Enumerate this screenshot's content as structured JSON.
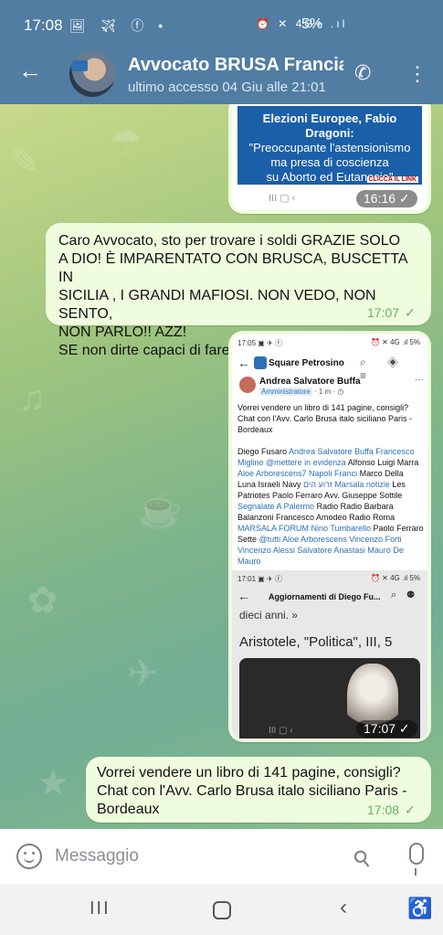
{
  "status_bar": {
    "time": "17:08",
    "left_icons": "🖼 ✈ ⓕ •",
    "right_icons": "⏰ ✕ 4G+ .ıl",
    "battery": "5%"
  },
  "header": {
    "contact_name": "Avvocato BRUSA Francia",
    "last_seen": "ultimo accesso 04 Giu alle 21:01",
    "back_icon": "arrow-left-icon",
    "call_icon": "phone-icon",
    "menu_icon": "more-vertical-icon"
  },
  "messages": {
    "image1": {
      "news_title": "Elezioni Europee, Fabio Dragoni:",
      "news_line1": "\"Preoccupante l'astensionismo",
      "news_line2": "ma presa di coscienza",
      "news_line3": "su Aborto ed Eutanasia\"",
      "news_link": "CLICCA IL LINK",
      "nav_glyphs": "III        ▢        ‹",
      "time": "16:16 ✓"
    },
    "text1": {
      "lines": [
        "Caro Avvocato, sto per trovare i soldi GRAZIE SOLO",
        "A DIO! È IMPARENTATO CON BRUSCA, BUSCETTA IN",
        "SICILIA , I GRANDI MAFIOSI. NON VEDO, NON SENTO,",
        "NON PARLO!! AZZ!",
        "SE non dirte capaci di fare il minimo. .."
      ],
      "time": "17:07",
      "tick": "✓"
    },
    "image2": {
      "status_time": "17:05 ▣ ✈ ⓕ",
      "status_right": "⏰ ✕ 4G .ıl 5%",
      "group_name": "Square Petrosino",
      "tools": "⌕ ◈ ≡",
      "author": "Andrea Salvatore Buffa",
      "role": "Amministratore",
      "age": "· 1 m · ◷",
      "more": "···",
      "post_text": "Vorrei vendere un libro di 141 pagine, consigli? Chat con l'Avv. Carlo Brusa italo siciliano Paris - Bordeaux",
      "tags_plain_1": "Diego Fusaro ",
      "tags_link_1": "Andrea Salvatore Buffa  Francesco Miglino  @mettere in evidenza",
      "tags_plain_2": "  Alfonso Luigi Marra  ",
      "tags_link_2": "Aloe Arborescens7  Napoli Franci",
      "tags_plain_3": "  Marco Della Luna  Israeli Navy ",
      "tags_link_3": "זרוע הים  Marsala notizie",
      "tags_plain_4": "  Les Patriotes  Paolo Ferraro  Avv. Giuseppe Sottile  ",
      "tags_link_4": "Segnalate A Palermo",
      "tags_plain_5": "  Radio Radio  Barbara Balanzoni  Francesco Amodeo  Radio Roma  ",
      "tags_link_5": "MARSALA FORUM  Nino Tumbarello",
      "tags_plain_6": "  Paolo Ferraro Sette  ",
      "tags_link_6": "@tutti Aloe Arborescens Vincenzo Forti Vincenzo Alessi Salvatore Anastasi Mauro De Mauro",
      "inner_status": "17:01 ▣ ✈ ⓕ",
      "inner_status_right": "⏰ ✕ 4G .ıl 5%",
      "inner_title": "Aggiornamenti di Diego Fu...",
      "inner_tools": "⌕ ⚉",
      "inner_quote": "dieci anni. »",
      "inner_source": "Aristotele, \"Politica\", III, 5",
      "nav_glyphs": "III        ▢        ‹",
      "time": "17:07 ✓"
    },
    "text2": {
      "lines": [
        "Vorrei vendere un libro di 141 pagine, consigli?",
        "Chat con l'Avv. Carlo Brusa italo siciliano Paris -",
        "Bordeaux"
      ],
      "time": "17:08",
      "tick": "✓"
    }
  },
  "input": {
    "placeholder": "Messaggio",
    "emoji_icon": "emoji-icon",
    "attach_icon": "paperclip-icon",
    "mic_icon": "microphone-icon"
  },
  "system_nav": {
    "recent": "III",
    "back": "‹",
    "accessibility": "♿"
  }
}
